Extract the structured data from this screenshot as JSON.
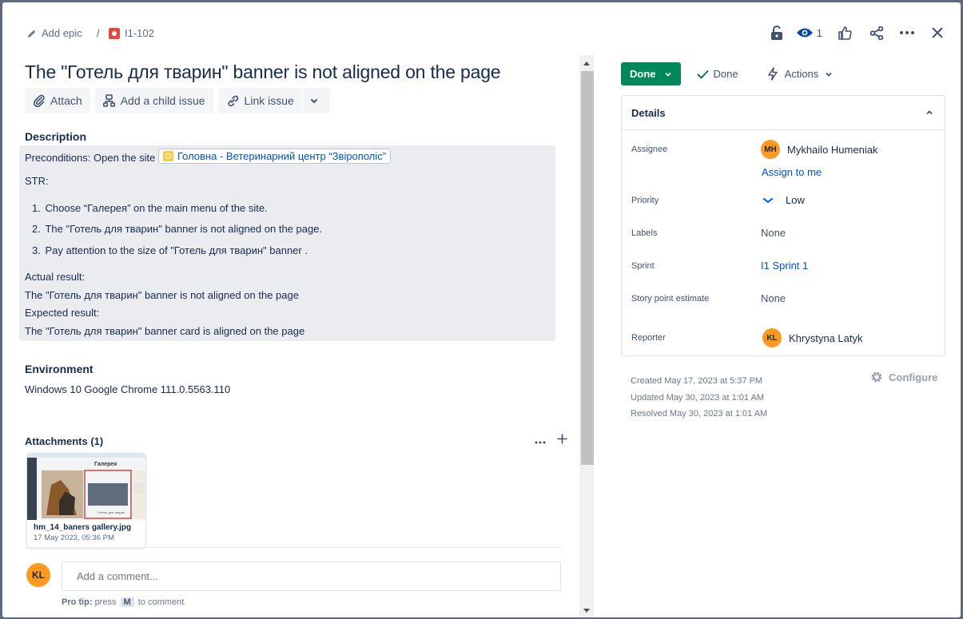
{
  "breadcrumb": {
    "parent_label": "Add epic",
    "separator": "/",
    "issue_key": "I1-102"
  },
  "top_actions": {
    "watch_count": "1"
  },
  "issue": {
    "title": "The \"Готель для тварин\" banner is not aligned on the page"
  },
  "toolbar": {
    "attach_label": "Attach",
    "add_child_label": "Add a child issue",
    "link_issue_label": "Link issue"
  },
  "description": {
    "heading": "Description",
    "preconditions_prefix": "Preconditions: Open the site",
    "link_text": "Головна - Ветеринарний центр “Звірополіс”",
    "str_label": "STR:",
    "steps": [
      "Choose “Галерея” on the main menu of the site.",
      "The \"Готель для тварин\" banner  is not aligned on the page.",
      "Pay attention to the size of \"Готель для тварин\" banner ."
    ],
    "step_numbers": [
      "1.",
      "2.",
      "3."
    ],
    "actual_label": "Actual result:",
    "actual_text": "The \"Готель для тварин\" banner  is not aligned on the page",
    "expected_label": "Expected result:",
    "expected_text": "The \"Готель для тварин\" banner  card is aligned on the page"
  },
  "environment": {
    "heading": "Environment",
    "value": "Windows 10 Google Chrome 111.0.5563.110"
  },
  "attachments": {
    "heading": "Attachments (1)",
    "items": [
      {
        "filename": "hm_14_baners gallery.jpg",
        "date": "17 May 2023, 05:36 PM",
        "preview_heading": "Галерея",
        "preview_caption": "Готель для тварин"
      }
    ]
  },
  "comment": {
    "avatar_initials": "KL",
    "placeholder": "Add a comment...",
    "protip_label": "Pro tip:",
    "protip_press": "press",
    "protip_key": "M",
    "protip_suffix": "to comment"
  },
  "status": {
    "current": "Done",
    "resolution": "Done",
    "actions_label": "Actions",
    "color": "#00875a"
  },
  "details": {
    "heading": "Details",
    "assignee_label": "Assignee",
    "assignee_initials": "MH",
    "assignee_name": "Mykhailo Humeniak",
    "assign_to_me": "Assign to me",
    "priority_label": "Priority",
    "priority_value": "Low",
    "labels_label": "Labels",
    "labels_value": "None",
    "sprint_label": "Sprint",
    "sprint_value": "I1 Sprint 1",
    "story_points_label": "Story point estimate",
    "story_points_value": "None",
    "reporter_label": "Reporter",
    "reporter_initials": "KL",
    "reporter_name": "Khrystyna Latyk"
  },
  "meta": {
    "created": "Created May 17, 2023 at 5:37 PM",
    "updated": "Updated May 30, 2023 at 1:01 AM",
    "resolved": "Resolved May 30, 2023 at 1:01 AM",
    "configure_label": "Configure"
  }
}
